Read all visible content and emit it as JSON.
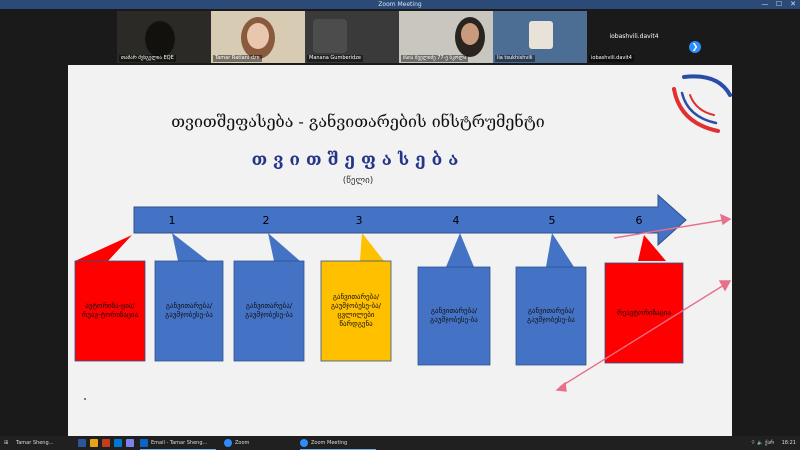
{
  "window": {
    "title": "Zoom Meeting",
    "minimize_glyph": "—",
    "maximize_glyph": "☐",
    "close_glyph": "✕"
  },
  "participants": [
    {
      "name": "თამარ შენგელია EQE"
    },
    {
      "name": "Tamar Ratiani dze"
    },
    {
      "name": "Manana Gumberidze"
    },
    {
      "name": "მაია შველიძე 77-ე სკოლა"
    },
    {
      "name": "lia tsukhishvili"
    },
    {
      "name": "iobashvili.davit4",
      "label": "iobashvili.davit4"
    }
  ],
  "gallery_next_icon": "next-page-icon",
  "slide": {
    "title": "თვითშეფასება - განვითარების ინსტრუმენტი",
    "subtitle": "თვითშეფასება",
    "note": "(წელი)",
    "steps": [
      "1",
      "2",
      "3",
      "4",
      "5",
      "6"
    ],
    "callouts": [
      {
        "text": "ავტორიზა-ცია/რეავ-ტორიზაცია",
        "color": "#ff0000"
      },
      {
        "text": "განვითარება/ გაუმჯობესე-ბა",
        "color": "#4472c4"
      },
      {
        "text": "განვითარება/ გაუმჯობესე-ბა",
        "color": "#4472c4"
      },
      {
        "text": "განვითარება/ გაუმჯობესე-ბა/ ცვლილები წარდგენა",
        "color": "#ffc000"
      },
      {
        "text": "განვითარება/ გაუმჯობესე-ბა",
        "color": "#4472c4"
      },
      {
        "text": "განვითარება/ გაუმჯობესე-ბა",
        "color": "#4472c4"
      },
      {
        "text": "რეავტორიზაცია",
        "color": "#ff0000"
      }
    ]
  },
  "taskbar": {
    "items": [
      {
        "label": "Tamar Sheng...",
        "icon": "app-icon"
      },
      {
        "label": "Email - Tamar Sheng...",
        "icon": "email-icon"
      },
      {
        "label": "Zoom",
        "icon": "zoom-icon"
      },
      {
        "label": "Zoom Meeting",
        "icon": "zoom-meeting-icon"
      }
    ],
    "language": "ქარ",
    "time": "18:21"
  }
}
